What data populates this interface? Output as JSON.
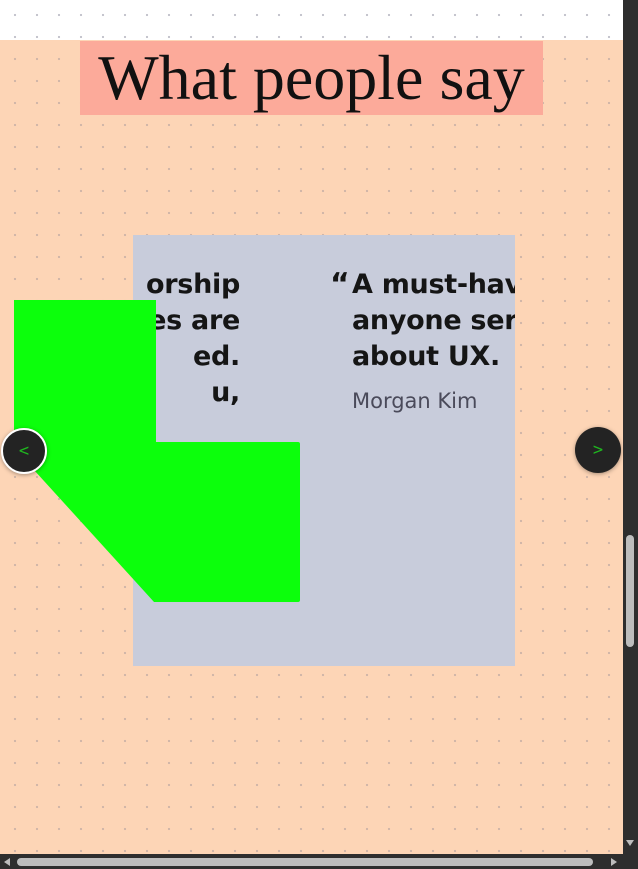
{
  "section": {
    "title": "What people say"
  },
  "testimonials": [
    {
      "quote": "orship\nrces are\ned.\nu,",
      "author": ""
    },
    {
      "quote_mark": "“",
      "quote": "A must-have\nanyone serio\nabout UX.",
      "author": "Morgan Kim"
    }
  ],
  "carousel": {
    "prev_label": "<",
    "next_label": ">"
  },
  "colors": {
    "page_background": "#fdd5b6",
    "title_highlight": "#fcaa9a",
    "panel_background": "#c8ccdb",
    "overlay_shape": "#0cff0c",
    "nav_button": "#232323",
    "nav_arrow": "#1fb71f"
  }
}
